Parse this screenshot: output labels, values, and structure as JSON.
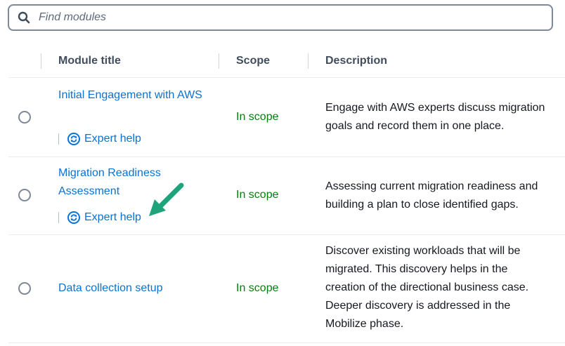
{
  "search": {
    "placeholder": "Find modules",
    "icon": "search-icon"
  },
  "table": {
    "columns": [
      "Module title",
      "Scope",
      "Description"
    ],
    "rows": [
      {
        "title": "Initial Engagement with AWS",
        "expert_help": "Expert help",
        "scope": "In scope",
        "description": "Engage with AWS experts discuss migration goals and record them in one place."
      },
      {
        "title": "Migration Readiness Assessment",
        "expert_help": "Expert help",
        "scope": "In scope",
        "description": "Assessing current migration readiness and building a plan to close identified gaps."
      },
      {
        "title": "Data collection setup",
        "scope": "In scope",
        "description": "Discover existing workloads that will be migrated. This discovery helps in the creation of the directional business case. Deeper discovery is addressed in the Mobilize phase."
      }
    ]
  },
  "colors": {
    "link": "#0972d3",
    "scope": "#037f0c",
    "annotation_arrow": "#1fa37a"
  }
}
